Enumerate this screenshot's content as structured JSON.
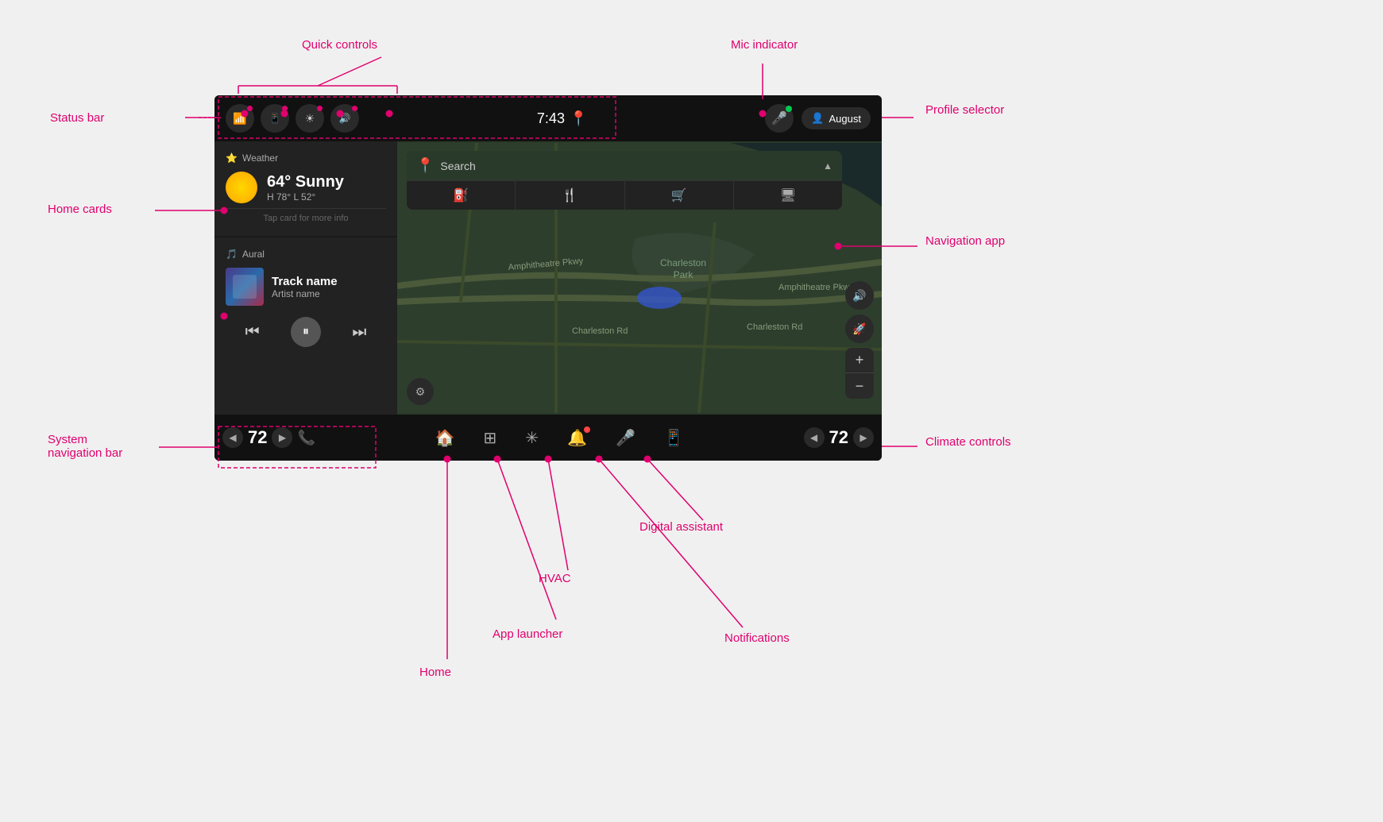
{
  "annotations": {
    "quick_controls": "Quick controls",
    "status_bar": "Status bar",
    "home_cards": "Home cards",
    "mic_indicator": "Mic indicator",
    "profile_selector": "Profile selector",
    "navigation_app": "Navigation app",
    "system_navigation_bar": "System\nnavigation bar",
    "climate_controls": "Climate controls",
    "digital_assistant": "Digital assistant",
    "notifications": "Notifications",
    "hvac": "HVAC",
    "app_launcher": "App launcher",
    "home": "Home"
  },
  "status_bar": {
    "time": "7:43",
    "profile_name": "August",
    "quick_controls": [
      "bluetooth",
      "signal",
      "brightness",
      "volume"
    ]
  },
  "weather_card": {
    "app_name": "Weather",
    "temperature": "64° Sunny",
    "high_low": "H 78° L 52°",
    "hint": "Tap card for more info"
  },
  "music_card": {
    "app_name": "Aural",
    "track_name": "Track name",
    "artist_name": "Artist name"
  },
  "search": {
    "placeholder": "Search",
    "filters": [
      "⛽",
      "🍴",
      "🛒",
      "💻"
    ]
  },
  "map": {
    "road1": "Amphitheatre Pkwy",
    "road2": "Amphitheatre Pkwy",
    "road3": "Charleston Rd",
    "road4": "Charleston Rd",
    "park": "Charleston\nPark"
  },
  "bottom_nav": {
    "left_temp": "72",
    "right_temp": "72",
    "items": [
      "home",
      "app-launcher",
      "hvac",
      "notifications",
      "digital-assistant",
      "phone"
    ]
  }
}
